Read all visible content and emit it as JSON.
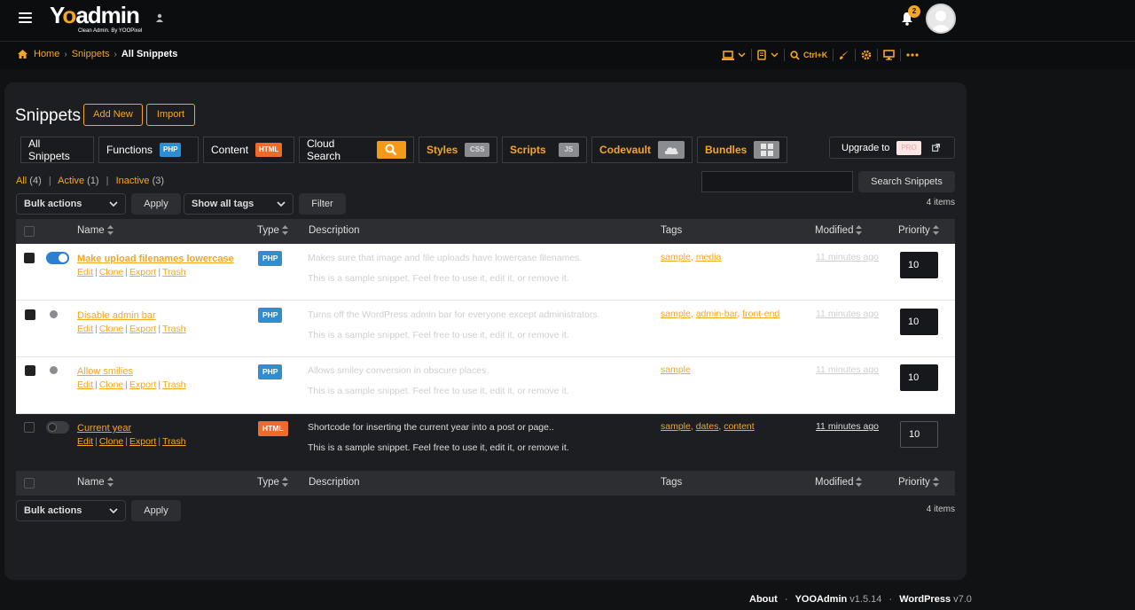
{
  "colors": {
    "accent": "#f5a623",
    "php": "#2d8fd2",
    "html": "#f06a2a",
    "toggle_on": "#2d7fd2"
  },
  "topbar": {
    "logo_main": "Yoadmin",
    "logo_sub": "Clean Admin. By YOOPixel",
    "notification_count": "2"
  },
  "breadcrumb": {
    "home": "Home",
    "snippets": "Snippets",
    "current": "All Snippets"
  },
  "toolbar": {
    "search_shortcut": "Ctrl+K"
  },
  "page": {
    "title": "Snippets",
    "add_new": "Add New",
    "import": "Import"
  },
  "tabs": [
    {
      "label": "All Snippets",
      "pill": ""
    },
    {
      "label": "Functions",
      "pill": "PHP"
    },
    {
      "label": "Content",
      "pill": "HTML"
    },
    {
      "label": "Cloud Search",
      "pill": ""
    },
    {
      "label": "Styles",
      "pill": "CSS"
    },
    {
      "label": "Scripts",
      "pill": "JS"
    },
    {
      "label": "Codevault",
      "pill": ""
    },
    {
      "label": "Bundles",
      "pill": ""
    }
  ],
  "upgrade": {
    "label": "Upgrade to",
    "pro": "PRO"
  },
  "filters": {
    "all": "All",
    "all_count": "(4)",
    "active": "Active",
    "active_count": "(1)",
    "inactive": "Inactive",
    "inactive_count": "(3)",
    "separator": "|",
    "bulk_actions": "Bulk actions",
    "apply": "Apply",
    "tags_select": "Show all tags",
    "filter": "Filter",
    "search_button": "Search Snippets",
    "items": "4 items"
  },
  "table": {
    "columns": {
      "name": "Name",
      "type": "Type",
      "description": "Description",
      "tags": "Tags",
      "modified": "Modified",
      "priority": "Priority"
    },
    "rows": [
      {
        "name": "Make upload filenames lowercase",
        "type": "PHP",
        "desc1": "Makes sure that image and file uploads have lowercase filenames.",
        "desc2": "This is a sample snippet. Feel free to use it, edit it, or remove it.",
        "tags": [
          "sample",
          "media"
        ],
        "modified": "11 minutes ago",
        "priority": "10",
        "active": true
      },
      {
        "name": "Disable admin bar",
        "type": "PHP",
        "desc1": "Turns off the WordPress admin bar for everyone except administrators.",
        "desc2": "This is a sample snippet. Feel free to use it, edit it, or remove it.",
        "tags": [
          "sample",
          "admin-bar",
          "front-end"
        ],
        "modified": "11 minutes ago",
        "priority": "10",
        "active": false
      },
      {
        "name": "Allow smilies",
        "type": "PHP",
        "desc1": "Allows smiley conversion in obscure places.",
        "desc2": "This is a sample snippet. Feel free to use it, edit it, or remove it.",
        "tags": [
          "sample"
        ],
        "modified": "11 minutes ago",
        "priority": "10",
        "active": false
      },
      {
        "name": "Current year",
        "type": "HTML",
        "desc1": "Shortcode for inserting the current year into a post or page..",
        "desc2": "This is a sample snippet. Feel free to use it, edit it, or remove it.",
        "tags": [
          "sample",
          "dates",
          "content"
        ],
        "modified": "11 minutes ago",
        "priority": "10",
        "active": false
      }
    ],
    "row_actions": {
      "edit": "Edit",
      "clone": "Clone",
      "export": "Export",
      "trash": "Trash"
    }
  },
  "footer": {
    "about": "About",
    "yooadmin": "YOOAdmin",
    "yoo_version": "v1.5.14",
    "wordpress": "WordPress",
    "wp_version": "v7.0",
    "dot": "·"
  }
}
